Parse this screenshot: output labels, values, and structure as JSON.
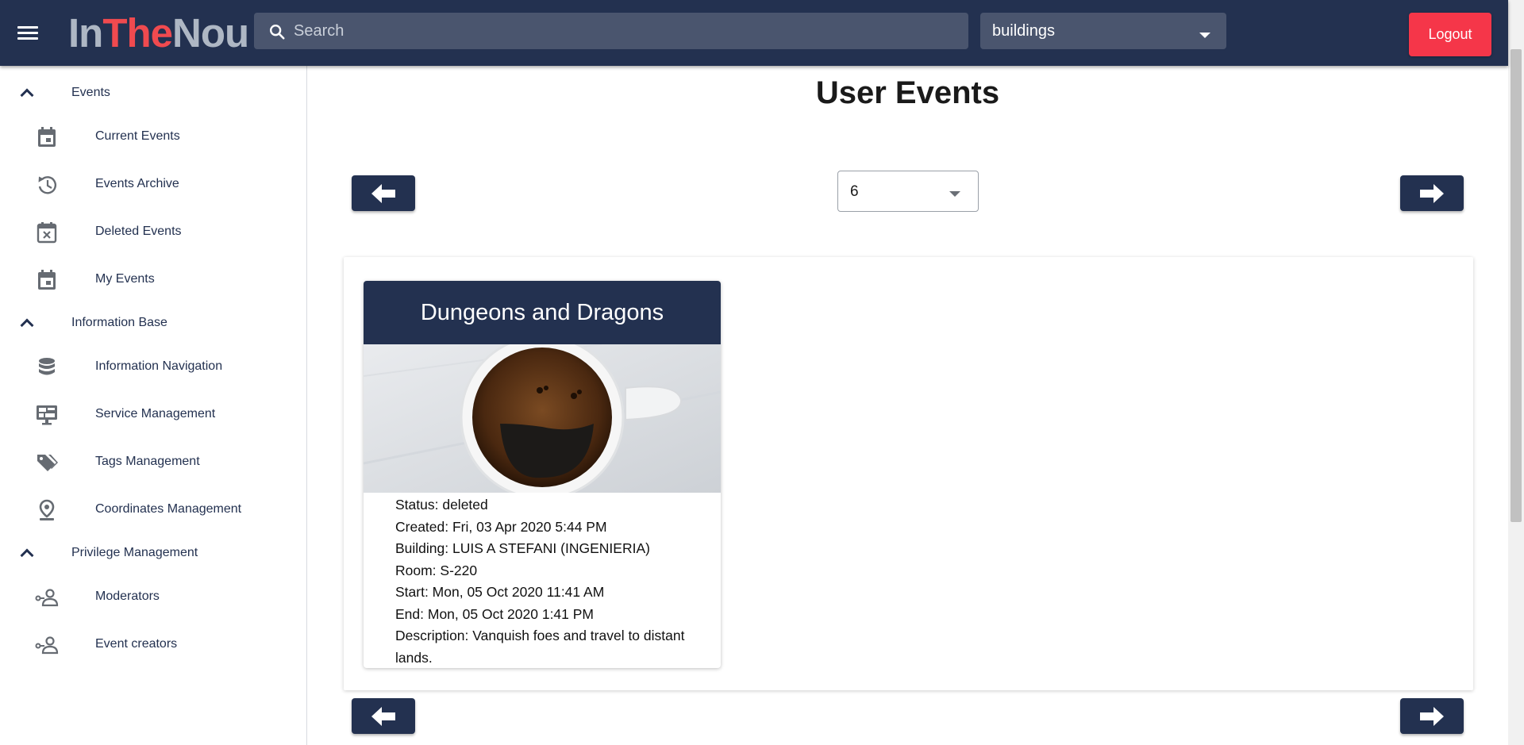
{
  "header": {
    "logo": {
      "part1": "In",
      "part2": "The",
      "part3": "Nou"
    },
    "search_placeholder": "Search",
    "building_select_value": "buildings",
    "logout_label": "Logout",
    "colors": {
      "bar": "#233150",
      "accent_red": "#f53649",
      "logo_gray": "#aeb7c4",
      "logo_red": "#f04a4f"
    }
  },
  "sidebar": {
    "sections": [
      {
        "label": "Events",
        "items": [
          {
            "label": "Current Events",
            "icon": "calendar-icon"
          },
          {
            "label": "Events Archive",
            "icon": "history-icon"
          },
          {
            "label": "Deleted Events",
            "icon": "calendar-remove-icon"
          },
          {
            "label": "My Events",
            "icon": "calendar-icon"
          }
        ]
      },
      {
        "label": "Information Base",
        "items": [
          {
            "label": "Information Navigation",
            "icon": "database-icon"
          },
          {
            "label": "Service Management",
            "icon": "monitor-dashboard-icon"
          },
          {
            "label": "Tags Management",
            "icon": "tags-icon"
          },
          {
            "label": "Coordinates Management",
            "icon": "map-marker-icon"
          }
        ]
      },
      {
        "label": "Privilege Management",
        "items": [
          {
            "label": "Moderators",
            "icon": "account-key-icon"
          },
          {
            "label": "Event creators",
            "icon": "account-key-icon"
          }
        ]
      }
    ]
  },
  "main": {
    "title": "User Events",
    "page_size_value": "6",
    "event": {
      "title": "Dungeons and Dragons",
      "image": "coffee-cup-smiley",
      "status": "Status: deleted",
      "created": "Created: Fri, 03 Apr 2020 5:44 PM",
      "building": "Building: LUIS A STEFANI (INGENIERIA)",
      "room": "Room: S-220",
      "start": "Start: Mon, 05 Oct 2020 11:41 AM",
      "end": "End: Mon, 05 Oct 2020 1:41 PM",
      "description": "Description: Vanquish foes and travel to distant lands."
    }
  }
}
